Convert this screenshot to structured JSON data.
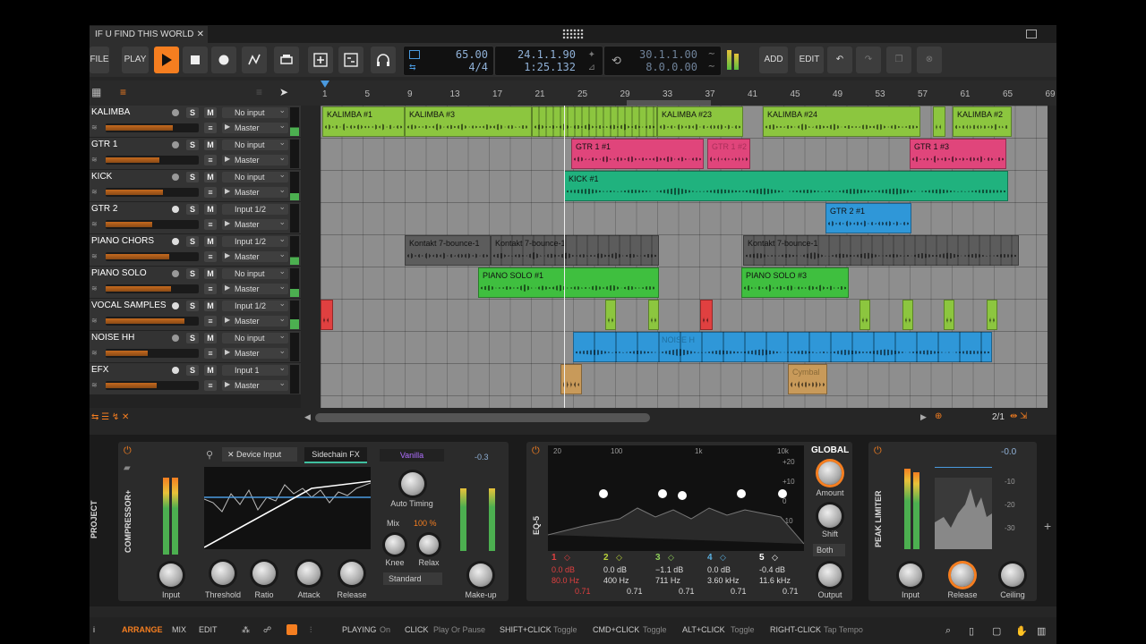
{
  "tab": {
    "title": "IF U FIND THIS WORLD B...",
    "modified": "*",
    "close": "✕"
  },
  "toolbar": {
    "file": "FILE",
    "play": "PLAY",
    "add": "ADD",
    "edit": "EDIT",
    "tempo": "65.00",
    "signature": "4/4",
    "position_bars": "24.1.1.90",
    "position_time": "1:25.132",
    "loop_start": "30.1.1.00",
    "loop_length": "8.0.0.00"
  },
  "ruler": [
    "1",
    "5",
    "9",
    "13",
    "17",
    "21",
    "25",
    "29",
    "33",
    "37",
    "41",
    "45",
    "49",
    "53",
    "57",
    "61",
    "65",
    "69"
  ],
  "tracks": [
    {
      "name": "KALIMBA",
      "input": "No input",
      "output": "Master",
      "level": 0.72
    },
    {
      "name": "GTR 1",
      "input": "No input",
      "output": "Master",
      "level": 0.58
    },
    {
      "name": "KICK",
      "input": "No input",
      "output": "Master",
      "level": 0.62
    },
    {
      "name": "GTR 2",
      "input": "Input 1/2",
      "output": "Master",
      "level": 0.5
    },
    {
      "name": "PIANO CHORS",
      "input": "Input 1/2",
      "output": "Master",
      "level": 0.68
    },
    {
      "name": "PIANO SOLO",
      "input": "No input",
      "output": "Master",
      "level": 0.7
    },
    {
      "name": "VOCAL SAMPLES",
      "input": "Input 1/2",
      "output": "Master",
      "level": 0.85
    },
    {
      "name": "NOISE HH",
      "input": "No input",
      "output": "Master",
      "level": 0.45
    },
    {
      "name": "EFX",
      "input": "Input 1",
      "output": "Master",
      "level": 0.55
    }
  ],
  "clips": {
    "kalimba1": "KALIMBA #1",
    "kalimba3": "KALIMBA #3",
    "kalimba23": "KALIMBA #23",
    "kalimba24": "KALIMBA #24",
    "kalimba2": "KALIMBA #2",
    "gtr1_1": "GTR 1 #1",
    "gtr1_2": "GTR 1 #2",
    "gtr1_3": "GTR 1 #3",
    "kick1": "KICK #1",
    "gtr2_1": "GTR 2 #1",
    "kontakt": "Kontakt 7-bounce-1",
    "piano_solo1": "PIANO SOLO #1",
    "piano_solo3": "PIANO SOLO #3",
    "noise": "NOISE H",
    "cymbal": "Cymbal"
  },
  "arrange_footer": {
    "page": "2/1"
  },
  "devices": {
    "project": "PROJECT",
    "compressor": {
      "name": "COMPRESSOR+",
      "sidechain_input": "Device Input",
      "sidechain_fx": "Sidechain FX",
      "preset": "Vanilla",
      "auto_timing": "Auto Timing",
      "mix_label": "Mix",
      "mix_value": "100 %",
      "knee": "Knee",
      "relax": "Relax",
      "mode": "Standard",
      "input": "Input",
      "threshold": "Threshold",
      "ratio": "Ratio",
      "attack": "Attack",
      "release": "Release",
      "makeup": "Make-up",
      "meter": "-0.3"
    },
    "eq": {
      "name": "EQ-5",
      "freq_ticks": [
        "20",
        "100",
        "1k",
        "10k"
      ],
      "db_ticks": [
        "+20",
        "+10",
        "0",
        "-10",
        "-20"
      ],
      "global": "GLOBAL",
      "amount": "Amount",
      "shift": "Shift",
      "channel": "Both",
      "output": "Output",
      "bands": [
        {
          "n": "1",
          "gain": "0.0 dB",
          "freq": "80.0 Hz",
          "q": "0.71",
          "color": "#e04040"
        },
        {
          "n": "2",
          "gain": "0.0 dB",
          "freq": "400 Hz",
          "q": "0.71",
          "color": "#b9d23a"
        },
        {
          "n": "3",
          "gain": "−1.1 dB",
          "freq": "711 Hz",
          "q": "0.71",
          "color": "#8fd05a"
        },
        {
          "n": "4",
          "gain": "0.0 dB",
          "freq": "3.60 kHz",
          "q": "0.71",
          "color": "#5ab0e0"
        },
        {
          "n": "5",
          "gain": "-0.4 dB",
          "freq": "11.6 kHz",
          "q": "0.71",
          "color": "#ffffff"
        }
      ]
    },
    "limiter": {
      "name": "PEAK LIMITER",
      "readout": "-0.0",
      "scale": [
        "-10",
        "-20",
        "-30"
      ],
      "input": "Input",
      "release": "Release",
      "ceiling": "Ceiling"
    }
  },
  "status": {
    "arrange": "ARRANGE",
    "mix": "MIX",
    "edit": "EDIT",
    "playing": "PLAYING",
    "playing_val": "On",
    "click": "CLICK",
    "click_val": "Play Or Pause",
    "shift_click": "SHIFT+CLICK",
    "shift_val": "Toggle",
    "cmd_click": "CMD+CLICK",
    "cmd_val": "Toggle",
    "alt_click": "ALT+CLICK",
    "alt_val": "Toggle",
    "right_click": "RIGHT-CLICK",
    "right_val": "Tap Tempo"
  },
  "colors": {
    "accent": "#f57e20",
    "kalimba": "#8cc63f",
    "gtr1": "#e0457b",
    "kick": "#20b27e",
    "gtr2": "#2f97d8",
    "kontakt": "#5c5c5c",
    "piano": "#3fbf3f",
    "vocal": "#8cc63f",
    "noise": "#2f97d8",
    "efx": "#c89a5a"
  }
}
